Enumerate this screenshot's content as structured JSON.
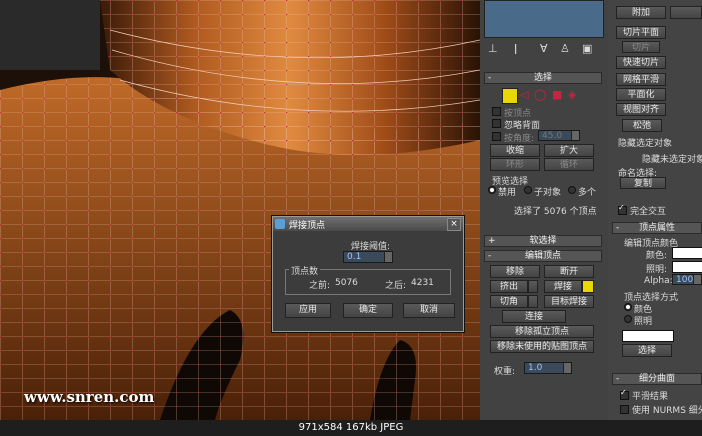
{
  "watermark": "www.snren.com",
  "dialog": {
    "title": "焊接顶点",
    "threshold_label": "焊接阈值:",
    "threshold_value": "0.1",
    "vertex_count_label": "顶点数",
    "before_label": "之前:",
    "before_value": "5076",
    "after_label": "之后:",
    "after_value": "4231",
    "apply": "应用",
    "ok": "确定",
    "cancel": "取消",
    "close": "×"
  },
  "panel": {
    "selection_title": "选择",
    "by_vertex": "按顶点",
    "ignore_backfacing": "忽略背面",
    "by_angle": "按角度:",
    "angle_value": "45.0",
    "shrink": "收缩",
    "grow": "扩大",
    "ring": "环形",
    "loop": "循环",
    "preview_selection": "预览选择",
    "preview_off": "禁用",
    "preview_subobject": "子对象",
    "preview_multi": "多个",
    "selected_info": "选择了 5076 个顶点",
    "soft_selection": "软选择",
    "edit_vertices": "编辑顶点",
    "remove": "移除",
    "break": "断开",
    "extrude": "挤出",
    "weld": "焊接",
    "chamfer": "切角",
    "target_weld": "目标焊接",
    "connect": "连接",
    "remove_isolated": "移除孤立顶点",
    "remove_unused_map": "移除未使用的贴图顶点",
    "weight_label": "权重:",
    "weight_value": "1.0",
    "plus": "+",
    "minus": "-"
  },
  "panel2": {
    "attach": "附加",
    "slice_plane": "切片平面",
    "slice": "切片",
    "quick_slice": "快速切片",
    "msmooth": "网格平滑",
    "planarize": "平面化",
    "view_align": "视图对齐",
    "relax": "松弛",
    "hide_selected": "隐藏选定对象",
    "hide_unselected": "隐藏未选定对象",
    "named_selections": "命名选择:",
    "copy": "复制",
    "full_interactivity": "完全交互",
    "vertex_properties": "顶点属性",
    "edit_vertex_colors": "编辑顶点颜色",
    "color_label": "颜色:",
    "illum_label": "照明:",
    "alpha_label": "Alpha:",
    "alpha_value": "100.0",
    "select_vertices_by": "顶点选择方式",
    "color_radio": "颜色",
    "illum_radio": "照明",
    "select_btn": "选择",
    "subdivision_surface": "细分曲面",
    "smooth_result": "平滑结果",
    "use_nurms": "使用 NURMS 细分"
  },
  "status": {
    "info": "971x584  167kb  JPEG"
  },
  "colors": {
    "accent_yellow": "#e8d800",
    "vertex_red": "#d02040",
    "panel_bg": "#424242"
  }
}
